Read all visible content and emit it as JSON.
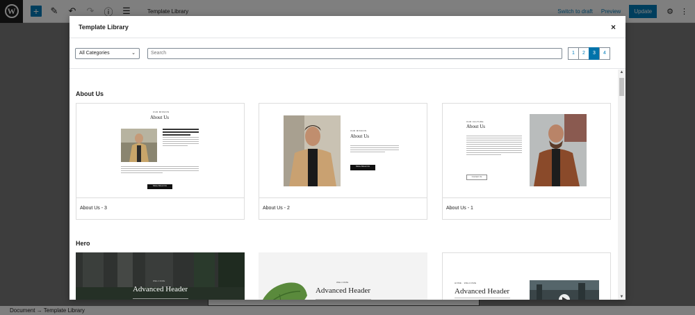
{
  "editor": {
    "doc_title": "Template Library",
    "switch_to_draft": "Switch to draft",
    "preview": "Preview",
    "update": "Update"
  },
  "statusbar": {
    "text": "Document  →  Template Library"
  },
  "modal": {
    "title": "Template Library",
    "close": "×"
  },
  "filters": {
    "category_selected": "All Categories",
    "search_placeholder": "Search"
  },
  "pager": {
    "pages": [
      "1",
      "2",
      "3",
      "4"
    ],
    "active": "3"
  },
  "sections": [
    {
      "title": "About Us",
      "cards": [
        {
          "label": "About Us - 3"
        },
        {
          "label": "About Us - 2"
        },
        {
          "label": "About Us - 1"
        }
      ]
    },
    {
      "title": "Hero",
      "cards": [
        {
          "heading": "Advanced Header"
        },
        {
          "heading": "Advanced Header"
        },
        {
          "heading": "Advanced Header"
        }
      ]
    }
  ],
  "colors": {
    "accent": "#007cba",
    "active_page": "#0073aa"
  },
  "icons": {
    "wp_logo": "wordpress-logo-icon",
    "add": "plus-icon",
    "edit": "pencil-icon",
    "undo": "undo-icon",
    "redo": "redo-icon",
    "info": "info-icon",
    "outline": "list-view-icon",
    "settings": "gear-icon",
    "more": "more-vertical-icon"
  }
}
